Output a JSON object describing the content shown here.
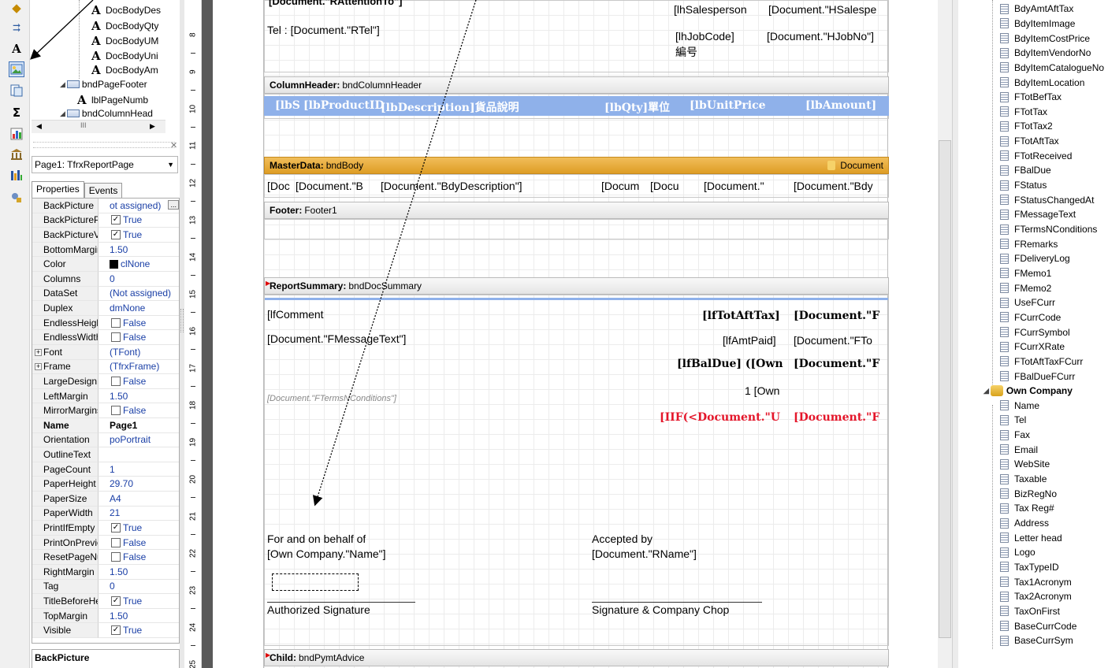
{
  "tree": {
    "items": [
      {
        "label": "DocBodyDes",
        "kind": "text"
      },
      {
        "label": "DocBodyQty",
        "kind": "text"
      },
      {
        "label": "DocBodyUM",
        "kind": "text"
      },
      {
        "label": "DocBodyUni",
        "kind": "text"
      },
      {
        "label": "DocBodyAm",
        "kind": "text"
      },
      {
        "label": "bndPageFooter",
        "kind": "band"
      },
      {
        "label": "lblPageNumb",
        "kind": "text"
      },
      {
        "label": "bndColumnHead",
        "kind": "band"
      }
    ],
    "scroll_text": "III"
  },
  "inspector": {
    "page_select": "Page1: TfrxReportPage",
    "tabs": [
      "Properties",
      "Events"
    ],
    "properties": [
      {
        "name": "BackPicture",
        "value": "ot assigned)",
        "ellipsis": "..."
      },
      {
        "name": "BackPicturePri",
        "value": "True",
        "check": true
      },
      {
        "name": "BackPictureVisi",
        "value": "True",
        "check": true
      },
      {
        "name": "BottomMargin",
        "value": "1.50"
      },
      {
        "name": "Color",
        "value": "clNone",
        "swatch": "#000000"
      },
      {
        "name": "Columns",
        "value": "0"
      },
      {
        "name": "DataSet",
        "value": "(Not assigned)"
      },
      {
        "name": "Duplex",
        "value": "dmNone"
      },
      {
        "name": "EndlessHeight",
        "value": "False",
        "check": false
      },
      {
        "name": "EndlessWidth",
        "value": "False",
        "check": false
      },
      {
        "name": "Font",
        "value": "(TFont)",
        "expander": "+"
      },
      {
        "name": "Frame",
        "value": "(TfrxFrame)",
        "expander": "+"
      },
      {
        "name": "LargeDesignHe",
        "value": "False",
        "check": false
      },
      {
        "name": "LeftMargin",
        "value": "1.50"
      },
      {
        "name": "MirrorMargins",
        "value": "False",
        "check": false
      },
      {
        "name": "Name",
        "value": "Page1",
        "bold": true
      },
      {
        "name": "Orientation",
        "value": "poPortrait"
      },
      {
        "name": "OutlineText",
        "value": ""
      },
      {
        "name": "PageCount",
        "value": "1"
      },
      {
        "name": "PaperHeight",
        "value": "29.70"
      },
      {
        "name": "PaperSize",
        "value": "A4"
      },
      {
        "name": "PaperWidth",
        "value": "21"
      },
      {
        "name": "PrintIfEmpty",
        "value": "True",
        "check": true
      },
      {
        "name": "PrintOnPreviou",
        "value": "False",
        "check": false
      },
      {
        "name": "ResetPageNun",
        "value": "False",
        "check": false
      },
      {
        "name": "RightMargin",
        "value": "1.50"
      },
      {
        "name": "Tag",
        "value": "0"
      },
      {
        "name": "TitleBeforeHea",
        "value": "True",
        "check": true
      },
      {
        "name": "TopMargin",
        "value": "1.50"
      },
      {
        "name": "Visible",
        "value": "True",
        "check": true
      }
    ],
    "description_title": "BackPicture"
  },
  "ruler": {
    "numbers": [
      "8",
      "9",
      "10",
      "11",
      "12",
      "13",
      "14",
      "15",
      "16",
      "17",
      "18",
      "19",
      "20",
      "21",
      "22",
      "23",
      "24",
      "25"
    ]
  },
  "design": {
    "top_cut_left": "[Document.\"RAttentionTo\"]",
    "top_cut_mid": "[lhSalesperson",
    "top_cut_right": "[Document.\"HSalespe",
    "tel": "Tel : [Document.\"RTel\"]",
    "jobcode": "[lhJobCode]",
    "jobcode_cn": "編号",
    "jobno": "[Document.\"HJobNo\"]",
    "colheader_title": "ColumnHeader:",
    "colheader_name": "bndColumnHeader",
    "colheader_cells": [
      "[lbS",
      "[lbProductID",
      "[lbDescription]貨品說明",
      "[lbQty]單位",
      "[lbUnitPrice",
      "[lbAmount]"
    ],
    "master_title": "MasterData:",
    "master_name": "bndBody",
    "master_ds": "Document",
    "master_cells": [
      "[Doc",
      "[Document.\"B",
      "[Document.\"BdyDescription\"]",
      "[Docum",
      "[Docu",
      "[Document.\"",
      "[Document.\"Bdy"
    ],
    "footer_title": "Footer:",
    "footer_name": "Footer1",
    "summary_title": "ReportSummary:",
    "summary_name": "bndDocSummary",
    "lfcomment": "[lfComment",
    "fmessage": "[Document.\"FMessageText\"]",
    "fterms": "[Document.\"FTermsNConditions\"]",
    "totaft_label": "[lfTotAftTax]",
    "totaft_val": "[Document.\"F",
    "amtpaid_label": "[lfAmtPaid]",
    "amtpaid_val": "[Document.\"FTo",
    "baldue_label": "[lfBalDue] ([Own",
    "baldue_val": "[Document.\"F",
    "one_own": "1 [Own",
    "iif_label": "[IIF(<Document.\"U",
    "iif_val": "[Document.\"F",
    "behalf1": "For and on behalf of",
    "behalf2": "[Own Company.\"Name\"]",
    "accepted1": "Accepted by",
    "accepted2": "[Document.\"RName\"]",
    "auth_sig": "Authorized Signature",
    "sig_chop": "Signature & Company Chop",
    "child_title": "Child:",
    "child_name": "bndPymtAdvice"
  },
  "datatree": {
    "fields_top": [
      "BdyAmtAftTax",
      "BdyItemImage",
      "BdyItemCostPrice",
      "BdyItemVendorNo",
      "BdyItemCatalogueNo",
      "BdyItemLocation",
      "FTotBefTax",
      "FTotTax",
      "FTotTax2",
      "FTotAftTax",
      "FTotReceived",
      "FBalDue",
      "FStatus",
      "FStatusChangedAt",
      "FMessageText",
      "FTermsNConditions",
      "FRemarks",
      "FDeliveryLog",
      "FMemo1",
      "FMemo2",
      "UseFCurr",
      "FCurrCode",
      "FCurrSymbol",
      "FCurrXRate",
      "FTotAftTaxFCurr",
      "FBalDueFCurr"
    ],
    "dataset": "Own Company",
    "fields_own": [
      "Name",
      "Tel",
      "Fax",
      "Email",
      "WebSite",
      "Taxable",
      "BizRegNo",
      "Tax Reg#",
      "Address",
      "Letter head",
      "Logo",
      "TaxTypeID",
      "Tax1Acronym",
      "Tax2Acronym",
      "TaxOnFirst",
      "BaseCurrCode",
      "BaseCurrSym"
    ]
  },
  "colors": {
    "accent_blue": "#8fb1ea",
    "band_orange": "#e3a62f",
    "red_text": "#e4162a"
  }
}
